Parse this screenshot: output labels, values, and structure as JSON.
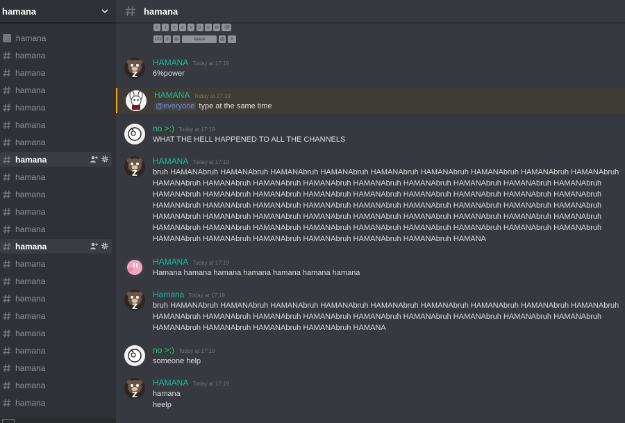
{
  "server": {
    "name": "hamana"
  },
  "channels": [
    {
      "name": "hamana",
      "icon": "checkbox-icon"
    },
    {
      "name": "hamana",
      "icon": "hash-icon"
    },
    {
      "name": "hamana",
      "icon": "hash-icon"
    },
    {
      "name": "hamana",
      "icon": "hash-icon"
    },
    {
      "name": "hamana",
      "icon": "hash-icon"
    },
    {
      "name": "hamana",
      "icon": "hash-icon"
    },
    {
      "name": "hamana",
      "icon": "hash-icon"
    },
    {
      "name": "hamana",
      "icon": "hash-icon",
      "active": true
    },
    {
      "name": "hamana",
      "icon": "hash-icon"
    },
    {
      "name": "hamana",
      "icon": "hash-icon"
    },
    {
      "name": "hamana",
      "icon": "hash-icon"
    },
    {
      "name": "hamana",
      "icon": "hash-icon"
    },
    {
      "name": "hamana",
      "icon": "hash-icon",
      "active": true
    },
    {
      "name": "hamana",
      "icon": "hash-icon"
    },
    {
      "name": "hamana",
      "icon": "hash-icon"
    },
    {
      "name": "hamana",
      "icon": "hash-icon"
    },
    {
      "name": "hamana",
      "icon": "hash-icon"
    },
    {
      "name": "hamana",
      "icon": "hash-icon"
    },
    {
      "name": "hamana",
      "icon": "hash-icon"
    },
    {
      "name": "hamana",
      "icon": "hash-icon"
    },
    {
      "name": "hamana",
      "icon": "hash-icon"
    },
    {
      "name": "hamana",
      "icon": "hash-icon"
    }
  ],
  "header": {
    "channel": "hamana"
  },
  "keyboard": {
    "row1": [
      "⇧",
      "z",
      "x",
      "c",
      "v",
      "b",
      "n",
      "m",
      "⌫"
    ],
    "row2": [
      "123",
      "◎",
      "◍",
      "space",
      "@",
      "#"
    ]
  },
  "messages": [
    {
      "author": "HAMANA",
      "author_color": "#1abc9c",
      "time": "Today at 17:19",
      "lines": [
        "6%power"
      ],
      "avatar": "bear-z-avatar"
    },
    {
      "author": "HAMANA",
      "author_color": "#1abc9c",
      "time": "Today at 17:19",
      "mention": "@everyone",
      "lines": [
        "type at the same time"
      ],
      "avatar": "bunny-avatar",
      "highlight": true
    },
    {
      "author": "no >:)",
      "author_color": "#2ecc71",
      "time": "Today at 17:19",
      "lines": [
        "WHAT THE HELL HAPPENED TO ALL THE CHANNELS"
      ],
      "avatar": "ghost-avatar"
    },
    {
      "author": "HAMANA",
      "author_color": "#1abc9c",
      "time": "Today at 17:19",
      "avatar": "bear-z-avatar",
      "lines": [
        "bruh HAMANAbruh HAMANAbruh HAMANAbruh HAMANAbruh HAMANAbruh HAMANAbruh HAMANAbruh HAMANAbruh HAMANAbruh",
        "HAMANAbruh HAMANAbruh HAMANAbruh HAMANAbruh HAMANAbruh HAMANAbruh HAMANAbruh HAMANAbruh HAMANAbruh",
        "HAMANAbruh HAMANAbruh HAMANAbruh HAMANAbruh HAMANAbruh HAMANAbruh HAMANAbruh HAMANAbruh HAMANAbruh",
        "HAMANAbruh HAMANAbruh HAMANAbruh HAMANAbruh HAMANAbruh HAMANAbruh HAMANAbruh HAMANAbruh HAMANAbruh",
        "HAMANAbruh HAMANAbruh HAMANAbruh HAMANAbruh HAMANAbruh HAMANAbruh HAMANAbruh HAMANAbruh HAMANAbruh",
        "HAMANAbruh HAMANAbruh HAMANAbruh HAMANAbruh HAMANAbruh HAMANAbruh HAMANAbruh HAMANAbruh HAMANAbruh",
        "HAMANAbruh HAMANAbruh HAMANAbruh HAMANAbruh HAMANAbruh HAMANAbruh HAMANA"
      ]
    },
    {
      "author": "HAMANA",
      "author_color": "#1abc9c",
      "time": "Today at 17:19",
      "lines": [
        "Hamana hamana hamana hamana hamana hamana hamana"
      ],
      "avatar": "pig-avatar"
    },
    {
      "author": "Hamana",
      "author_color": "#1abc9c",
      "time": "Today at 17:19",
      "avatar": "bear-z-avatar",
      "lines": [
        "bruh HAMANAbruh HAMANAbruh HAMANAbruh HAMANAbruh HAMANAbruh HAMANAbruh HAMANAbruh HAMANAbruh HAMANAbruh",
        "HAMANAbruh HAMANAbruh HAMANAbruh HAMANAbruh HAMANAbruh HAMANAbruh HAMANAbruh HAMANAbruh HAMANAbruh",
        "HAMANAbruh HAMANAbruh HAMANAbruh HAMANAbruh HAMANA"
      ]
    },
    {
      "author": "no >:)",
      "author_color": "#2ecc71",
      "time": "Today at 17:19",
      "lines": [
        "someone help"
      ],
      "avatar": "ghost-avatar"
    },
    {
      "author": "HAMANA",
      "author_color": "#1abc9c",
      "time": "Today at 17:19",
      "lines": [
        "hamana",
        "heelp"
      ],
      "avatar": "bear-z-avatar"
    }
  ]
}
